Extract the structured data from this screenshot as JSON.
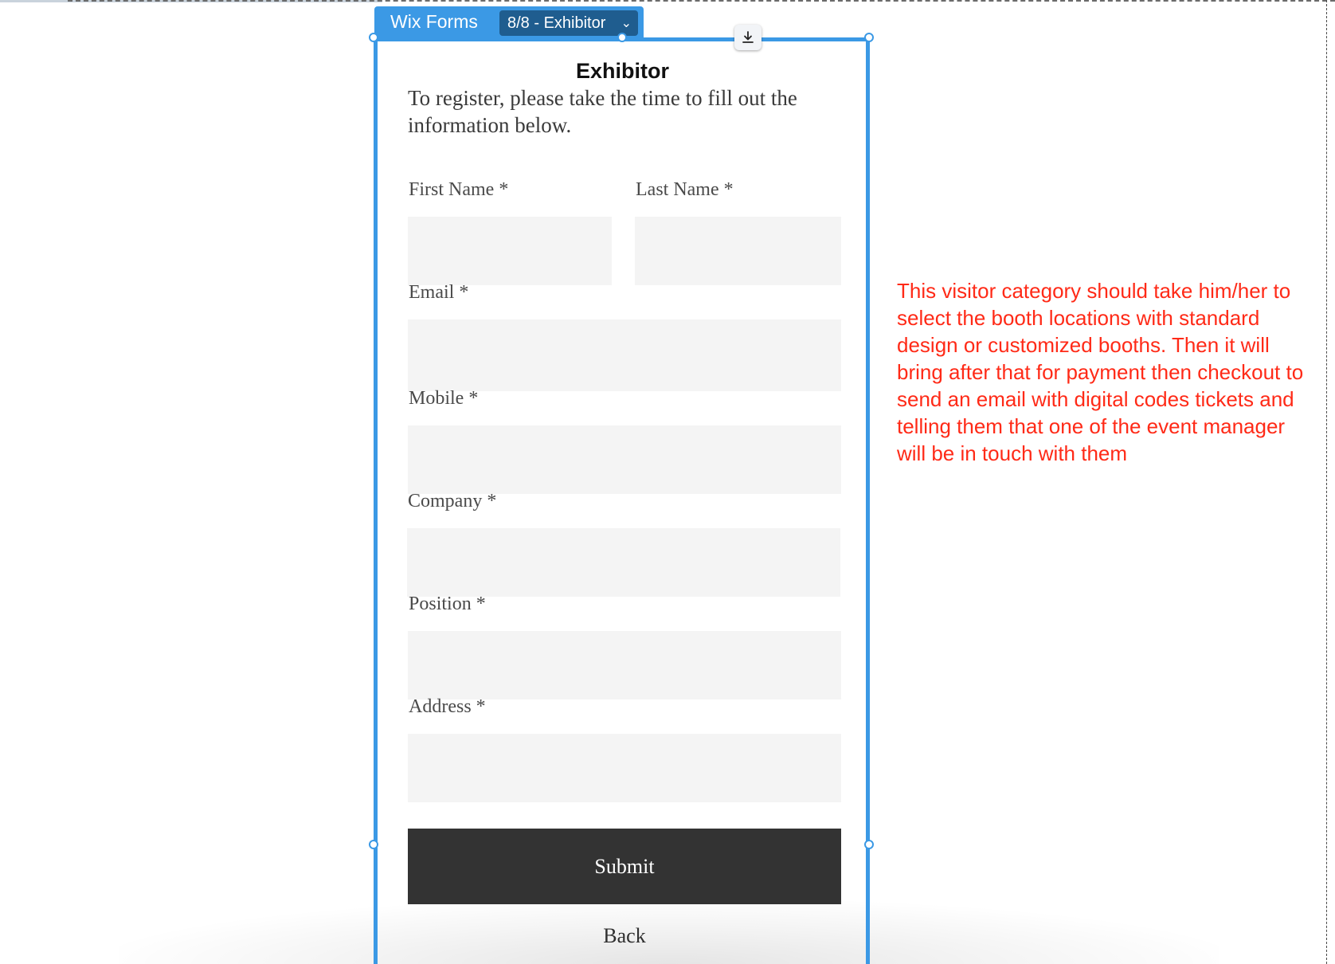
{
  "editor": {
    "app_label": "Wix Forms",
    "state_selector": "8/8 - Exhibitor",
    "download_icon": "download-icon",
    "chevron_icon": "chevron-down-icon",
    "accent_color": "#3b99e5"
  },
  "form": {
    "title": "Exhibitor",
    "intro": "To register, please take the time to fill out the information below.",
    "fields": {
      "first_name": "First Name *",
      "last_name": "Last Name *",
      "email": "Email *",
      "mobile": "Mobile *",
      "company": "Company *",
      "position": "Position *",
      "address": "Address *"
    },
    "submit_label": "Submit",
    "back_label": "Back"
  },
  "note": {
    "text": "This visitor category should take him/her to select the booth locations with standard design or customized booths. Then it will bring after that for payment then checkout to send an email with digital codes tickets and telling them that one of the event manager will be in touch with them",
    "color": "#ff2a17"
  }
}
